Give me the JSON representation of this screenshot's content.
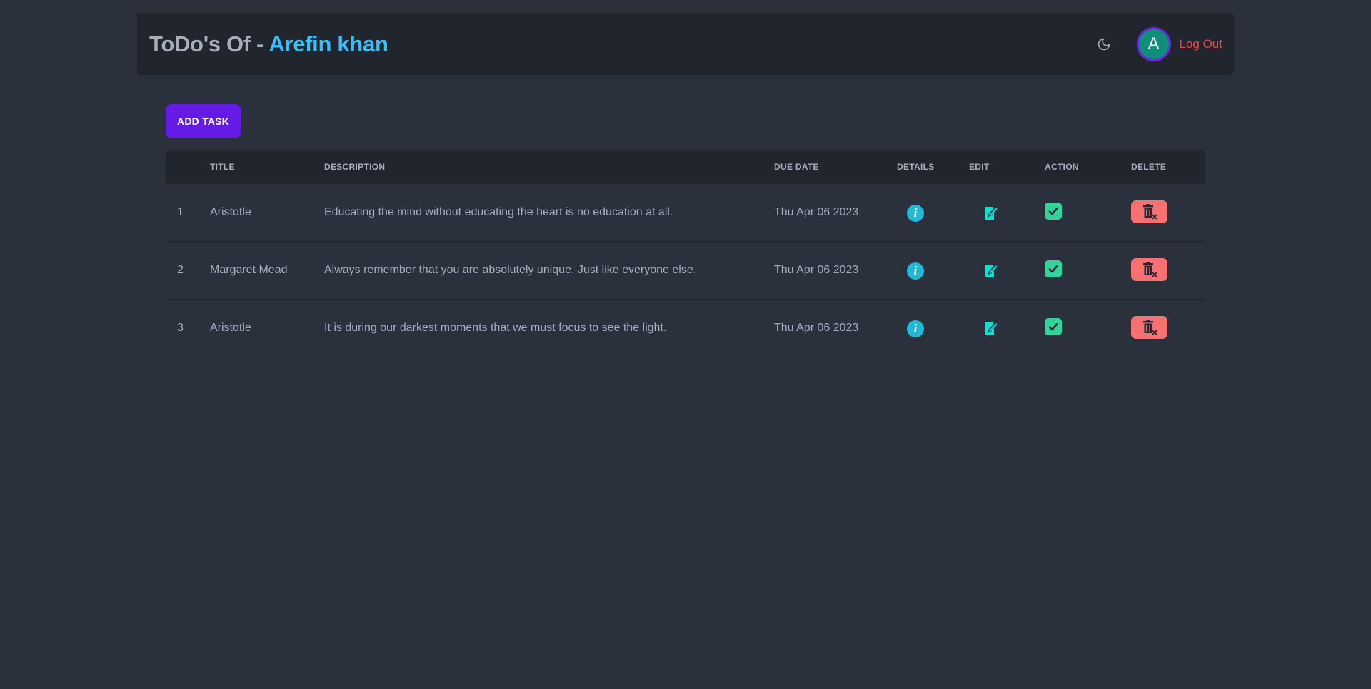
{
  "header": {
    "title_prefix": "ToDo's Of - ",
    "owner_name": "Arefin khan",
    "theme_icon": "moon-icon",
    "avatar_letter": "A",
    "logout_label": "Log Out"
  },
  "toolbar": {
    "add_task_label": "ADD TASK"
  },
  "table": {
    "columns": [
      "TITLE",
      "DESCRIPTION",
      "DUE DATE",
      "DETAILS",
      "EDIT",
      "ACTION",
      "DELETE"
    ],
    "rows": [
      {
        "num": "1",
        "title": "Aristotle",
        "description": "Educating the mind without educating the heart is no education at all.",
        "due": "Thu Apr 06 2023"
      },
      {
        "num": "2",
        "title": "Margaret Mead",
        "description": "Always remember that you are absolutely unique. Just like everyone else.",
        "due": "Thu Apr 06 2023"
      },
      {
        "num": "3",
        "title": "Aristotle",
        "description": "It is during our darkest moments that we must focus to see the light.",
        "due": "Thu Apr 06 2023"
      }
    ],
    "icons": {
      "details": "info-icon",
      "edit": "edit-icon",
      "action": "check-icon",
      "delete": "trash-icon"
    }
  },
  "colors": {
    "background": "#2a303c",
    "navbar": "#20252e",
    "accent_name": "#3abff8",
    "primary_button": "#661ae6",
    "logout": "#ef4444",
    "info": "#22b8d8",
    "edit": "#0fe0d0",
    "check": "#34d399",
    "delete": "#f87171"
  }
}
